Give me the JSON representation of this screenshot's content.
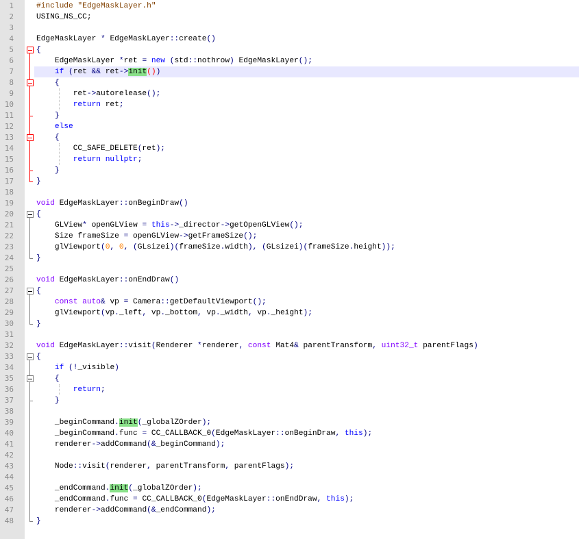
{
  "editor": {
    "lines": [
      {
        "n": "1",
        "segs": [
          [
            "pp",
            "#include \"EdgeMaskLayer.h\""
          ]
        ]
      },
      {
        "n": "2",
        "segs": [
          [
            "",
            "USING_NS_CC;"
          ]
        ]
      },
      {
        "n": "3",
        "segs": []
      },
      {
        "n": "4",
        "segs": [
          [
            "",
            "EdgeMaskLayer "
          ],
          [
            "op",
            "* "
          ],
          [
            "",
            "EdgeMaskLayer"
          ],
          [
            "op",
            "::"
          ],
          [
            "",
            "create"
          ],
          [
            "op",
            "()"
          ]
        ]
      },
      {
        "n": "5",
        "segs": [
          [
            "op",
            "{"
          ]
        ]
      },
      {
        "n": "6",
        "segs": [
          [
            "",
            "    EdgeMaskLayer "
          ],
          [
            "op",
            "*"
          ],
          [
            "",
            "ret "
          ],
          [
            "op",
            "= "
          ],
          [
            "kw",
            "new "
          ],
          [
            "op",
            "("
          ],
          [
            "",
            "std"
          ],
          [
            "op",
            "::"
          ],
          [
            "",
            "nothrow"
          ],
          [
            "op",
            ") "
          ],
          [
            "",
            "EdgeMaskLayer"
          ],
          [
            "op",
            "();"
          ]
        ]
      },
      {
        "n": "7",
        "segs": [
          [
            "",
            "    "
          ],
          [
            "kw",
            "if "
          ],
          [
            "op",
            "("
          ],
          [
            "",
            "ret "
          ],
          [
            "op",
            "&& "
          ],
          [
            "",
            "ret"
          ],
          [
            "op",
            "->"
          ],
          [
            "gnote",
            "init"
          ],
          [
            "redp",
            "()"
          ],
          [
            "op",
            ")"
          ]
        ]
      },
      {
        "n": "8",
        "segs": [
          [
            "",
            "    "
          ],
          [
            "op",
            "{"
          ]
        ]
      },
      {
        "n": "9",
        "segs": [
          [
            "",
            "        ret"
          ],
          [
            "op",
            "->"
          ],
          [
            "",
            "autorelease"
          ],
          [
            "op",
            "();"
          ]
        ]
      },
      {
        "n": "10",
        "segs": [
          [
            "",
            "        "
          ],
          [
            "kw",
            "return "
          ],
          [
            "",
            "ret"
          ],
          [
            "op",
            ";"
          ]
        ]
      },
      {
        "n": "11",
        "segs": [
          [
            "",
            "    "
          ],
          [
            "op",
            "}"
          ]
        ]
      },
      {
        "n": "12",
        "segs": [
          [
            "",
            "    "
          ],
          [
            "kw",
            "else"
          ]
        ]
      },
      {
        "n": "13",
        "segs": [
          [
            "",
            "    "
          ],
          [
            "op",
            "{"
          ]
        ]
      },
      {
        "n": "14",
        "segs": [
          [
            "",
            "        CC_SAFE_DELETE"
          ],
          [
            "op",
            "("
          ],
          [
            "",
            "ret"
          ],
          [
            "op",
            ");"
          ]
        ]
      },
      {
        "n": "15",
        "segs": [
          [
            "",
            "        "
          ],
          [
            "kw",
            "return "
          ],
          [
            "kw",
            "nullptr"
          ],
          [
            "op",
            ";"
          ]
        ]
      },
      {
        "n": "16",
        "segs": [
          [
            "",
            "    "
          ],
          [
            "op",
            "}"
          ]
        ]
      },
      {
        "n": "17",
        "segs": [
          [
            "op",
            "}"
          ]
        ]
      },
      {
        "n": "18",
        "segs": []
      },
      {
        "n": "19",
        "segs": [
          [
            "tp",
            "void "
          ],
          [
            "",
            "EdgeMaskLayer"
          ],
          [
            "op",
            "::"
          ],
          [
            "",
            "onBeginDraw"
          ],
          [
            "op",
            "()"
          ]
        ]
      },
      {
        "n": "20",
        "segs": [
          [
            "op",
            "{"
          ]
        ]
      },
      {
        "n": "21",
        "segs": [
          [
            "",
            "    GLView"
          ],
          [
            "op",
            "* "
          ],
          [
            "",
            "openGLView "
          ],
          [
            "op",
            "= "
          ],
          [
            "kw",
            "this"
          ],
          [
            "op",
            "->"
          ],
          [
            "",
            "_director"
          ],
          [
            "op",
            "->"
          ],
          [
            "",
            "getOpenGLView"
          ],
          [
            "op",
            "();"
          ]
        ]
      },
      {
        "n": "22",
        "segs": [
          [
            "",
            "    Size frameSize "
          ],
          [
            "op",
            "= "
          ],
          [
            "",
            "openGLView"
          ],
          [
            "op",
            "->"
          ],
          [
            "",
            "getFrameSize"
          ],
          [
            "op",
            "();"
          ]
        ]
      },
      {
        "n": "23",
        "segs": [
          [
            "",
            "    glViewport"
          ],
          [
            "op",
            "("
          ],
          [
            "num",
            "0"
          ],
          [
            "op",
            ", "
          ],
          [
            "num",
            "0"
          ],
          [
            "op",
            ", ("
          ],
          [
            "",
            "GLsizei"
          ],
          [
            "op",
            ")("
          ],
          [
            "",
            "frameSize"
          ],
          [
            "op",
            "."
          ],
          [
            "",
            "width"
          ],
          [
            "op",
            "), ("
          ],
          [
            "",
            "GLsizei"
          ],
          [
            "op",
            ")("
          ],
          [
            "",
            "frameSize"
          ],
          [
            "op",
            "."
          ],
          [
            "",
            "height"
          ],
          [
            "op",
            "));"
          ]
        ]
      },
      {
        "n": "24",
        "segs": [
          [
            "op",
            "}"
          ]
        ]
      },
      {
        "n": "25",
        "segs": []
      },
      {
        "n": "26",
        "segs": [
          [
            "tp",
            "void "
          ],
          [
            "",
            "EdgeMaskLayer"
          ],
          [
            "op",
            "::"
          ],
          [
            "",
            "onEndDraw"
          ],
          [
            "op",
            "()"
          ]
        ]
      },
      {
        "n": "27",
        "segs": [
          [
            "op",
            "{"
          ]
        ]
      },
      {
        "n": "28",
        "segs": [
          [
            "",
            "    "
          ],
          [
            "tp",
            "const auto"
          ],
          [
            "op",
            "& "
          ],
          [
            "",
            "vp "
          ],
          [
            "op",
            "= "
          ],
          [
            "",
            "Camera"
          ],
          [
            "op",
            "::"
          ],
          [
            "",
            "getDefaultViewport"
          ],
          [
            "op",
            "();"
          ]
        ]
      },
      {
        "n": "29",
        "segs": [
          [
            "",
            "    glViewport"
          ],
          [
            "op",
            "("
          ],
          [
            "",
            "vp"
          ],
          [
            "op",
            "."
          ],
          [
            "",
            "_left"
          ],
          [
            "op",
            ", "
          ],
          [
            "",
            "vp"
          ],
          [
            "op",
            "."
          ],
          [
            "",
            "_bottom"
          ],
          [
            "op",
            ", "
          ],
          [
            "",
            "vp"
          ],
          [
            "op",
            "."
          ],
          [
            "",
            "_width"
          ],
          [
            "op",
            ", "
          ],
          [
            "",
            "vp"
          ],
          [
            "op",
            "."
          ],
          [
            "",
            "_height"
          ],
          [
            "op",
            ");"
          ]
        ]
      },
      {
        "n": "30",
        "segs": [
          [
            "op",
            "}"
          ]
        ]
      },
      {
        "n": "31",
        "segs": []
      },
      {
        "n": "32",
        "segs": [
          [
            "tp",
            "void "
          ],
          [
            "",
            "EdgeMaskLayer"
          ],
          [
            "op",
            "::"
          ],
          [
            "",
            "visit"
          ],
          [
            "op",
            "("
          ],
          [
            "",
            "Renderer "
          ],
          [
            "op",
            "*"
          ],
          [
            "",
            "renderer"
          ],
          [
            "op",
            ", "
          ],
          [
            "tp",
            "const "
          ],
          [
            "",
            "Mat4"
          ],
          [
            "op",
            "& "
          ],
          [
            "",
            "parentTransform"
          ],
          [
            "op",
            ", "
          ],
          [
            "tp",
            "uint32_t "
          ],
          [
            "",
            "parentFlags"
          ],
          [
            "op",
            ")"
          ]
        ]
      },
      {
        "n": "33",
        "segs": [
          [
            "op",
            "{"
          ]
        ]
      },
      {
        "n": "34",
        "segs": [
          [
            "",
            "    "
          ],
          [
            "kw",
            "if "
          ],
          [
            "op",
            "(!"
          ],
          [
            "",
            "_visible"
          ],
          [
            "op",
            ")"
          ]
        ]
      },
      {
        "n": "35",
        "segs": [
          [
            "",
            "    "
          ],
          [
            "op",
            "{"
          ]
        ]
      },
      {
        "n": "36",
        "segs": [
          [
            "",
            "        "
          ],
          [
            "kw",
            "return"
          ],
          [
            "op",
            ";"
          ]
        ]
      },
      {
        "n": "37",
        "segs": [
          [
            "",
            "    "
          ],
          [
            "op",
            "}"
          ]
        ]
      },
      {
        "n": "38",
        "segs": []
      },
      {
        "n": "39",
        "segs": [
          [
            "",
            "    _beginCommand"
          ],
          [
            "op",
            "."
          ],
          [
            "gnote",
            "init"
          ],
          [
            "op",
            "("
          ],
          [
            "",
            "_globalZOrder"
          ],
          [
            "op",
            ");"
          ]
        ]
      },
      {
        "n": "40",
        "segs": [
          [
            "",
            "    _beginCommand"
          ],
          [
            "op",
            "."
          ],
          [
            "",
            "func "
          ],
          [
            "op",
            "= "
          ],
          [
            "",
            "CC_CALLBACK_0"
          ],
          [
            "op",
            "("
          ],
          [
            "",
            "EdgeMaskLayer"
          ],
          [
            "op",
            "::"
          ],
          [
            "",
            "onBeginDraw"
          ],
          [
            "op",
            ", "
          ],
          [
            "kw",
            "this"
          ],
          [
            "op",
            ");"
          ]
        ]
      },
      {
        "n": "41",
        "segs": [
          [
            "",
            "    renderer"
          ],
          [
            "op",
            "->"
          ],
          [
            "",
            "addCommand"
          ],
          [
            "op",
            "(&"
          ],
          [
            "",
            "_beginCommand"
          ],
          [
            "op",
            ");"
          ]
        ]
      },
      {
        "n": "42",
        "segs": []
      },
      {
        "n": "43",
        "segs": [
          [
            "",
            "    Node"
          ],
          [
            "op",
            "::"
          ],
          [
            "",
            "visit"
          ],
          [
            "op",
            "("
          ],
          [
            "",
            "renderer"
          ],
          [
            "op",
            ", "
          ],
          [
            "",
            "parentTransform"
          ],
          [
            "op",
            ", "
          ],
          [
            "",
            "parentFlags"
          ],
          [
            "op",
            ");"
          ]
        ]
      },
      {
        "n": "44",
        "segs": []
      },
      {
        "n": "45",
        "segs": [
          [
            "",
            "    _endCommand"
          ],
          [
            "op",
            "."
          ],
          [
            "gnote",
            "init"
          ],
          [
            "op",
            "("
          ],
          [
            "",
            "_globalZOrder"
          ],
          [
            "op",
            ");"
          ]
        ]
      },
      {
        "n": "46",
        "segs": [
          [
            "",
            "    _endCommand"
          ],
          [
            "op",
            "."
          ],
          [
            "",
            "func "
          ],
          [
            "op",
            "= "
          ],
          [
            "",
            "CC_CALLBACK_0"
          ],
          [
            "op",
            "("
          ],
          [
            "",
            "EdgeMaskLayer"
          ],
          [
            "op",
            "::"
          ],
          [
            "",
            "onEndDraw"
          ],
          [
            "op",
            ", "
          ],
          [
            "kw",
            "this"
          ],
          [
            "op",
            ");"
          ]
        ]
      },
      {
        "n": "47",
        "segs": [
          [
            "",
            "    renderer"
          ],
          [
            "op",
            "->"
          ],
          [
            "",
            "addCommand"
          ],
          [
            "op",
            "(&"
          ],
          [
            "",
            "_endCommand"
          ],
          [
            "op",
            ");"
          ]
        ]
      },
      {
        "n": "48",
        "segs": [
          [
            "op",
            "}"
          ]
        ]
      }
    ]
  },
  "colors": {
    "gutter_bg": "#e4e4e4",
    "current_line_bg": "#e8e8ff",
    "keyword": "#0000ff",
    "type_keyword": "#8000ff",
    "preprocessor": "#804000",
    "number": "#ff8000",
    "operator": "#000080",
    "match_highlight": "#89e089",
    "fold_active": "#ff0000",
    "fold_normal": "#808080"
  },
  "current_line": 7,
  "folds": [
    {
      "open": 5,
      "close": 17,
      "active": true
    },
    {
      "open": 8,
      "close": 11,
      "active": true
    },
    {
      "open": 13,
      "close": 16,
      "active": true
    },
    {
      "open": 20,
      "close": 24,
      "active": false
    },
    {
      "open": 27,
      "close": 30,
      "active": false
    },
    {
      "open": 33,
      "close": 48,
      "active": false
    },
    {
      "open": 35,
      "close": 37,
      "active": false
    }
  ]
}
